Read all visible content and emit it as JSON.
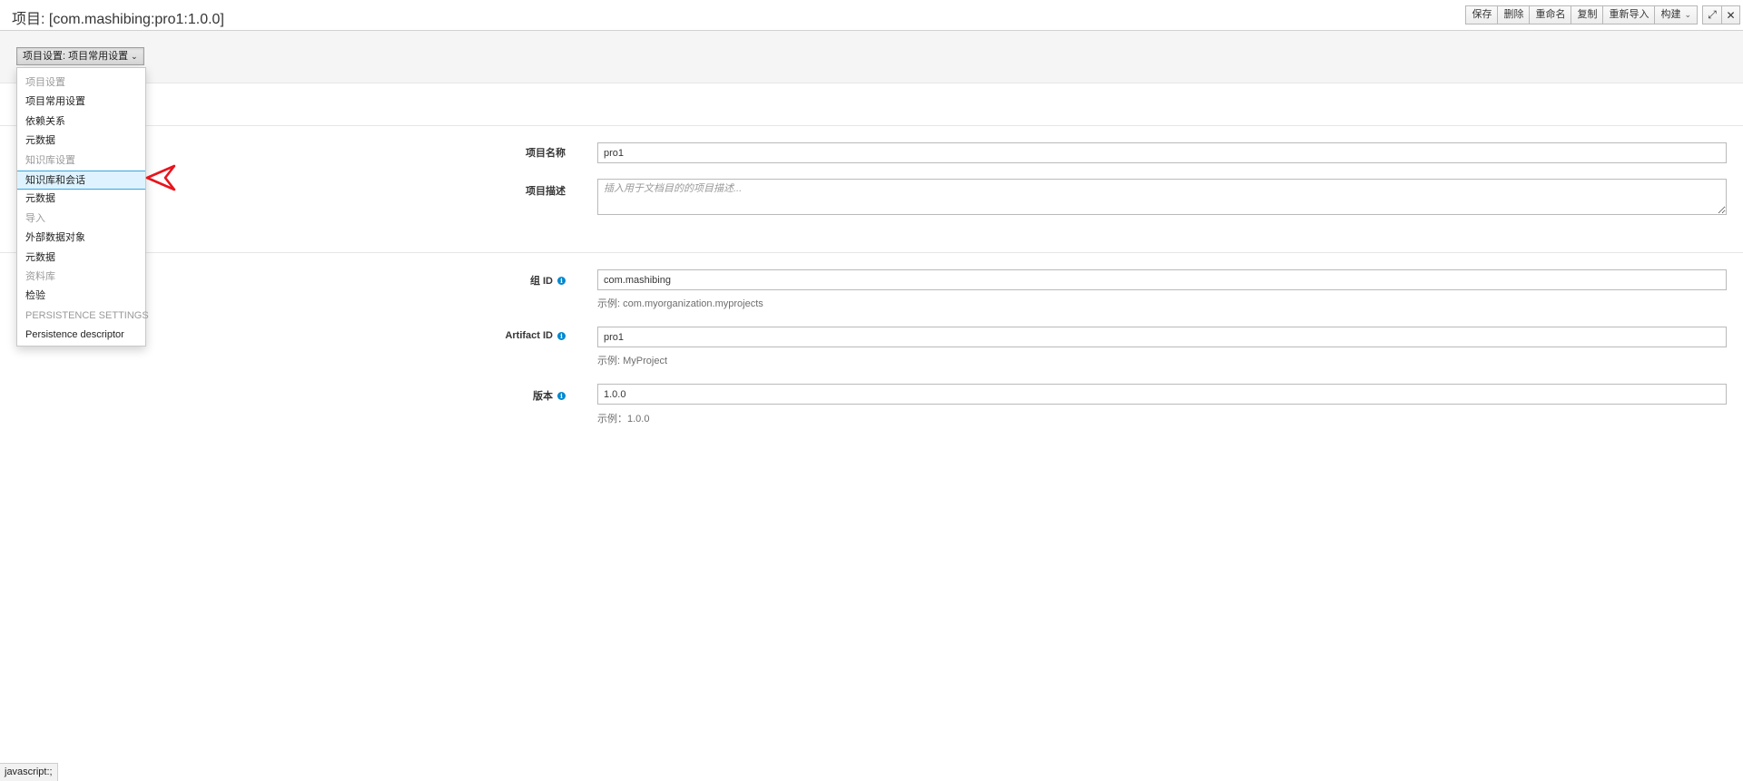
{
  "header": {
    "title": "项目: [com.mashibing:pro1:1.0.0]",
    "toolbar": [
      {
        "label": "保存",
        "name": "save-button"
      },
      {
        "label": "删除",
        "name": "delete-button"
      },
      {
        "label": "重命名",
        "name": "rename-button"
      },
      {
        "label": "复制",
        "name": "copy-button"
      },
      {
        "label": "重新导入",
        "name": "reimport-button"
      },
      {
        "label": "构建",
        "name": "build-button",
        "dropdown": true
      }
    ],
    "window_controls": {
      "maximize_icon": "expand-icon",
      "close_icon": "close-icon"
    }
  },
  "settings_bar": {
    "dropdown_label": "项目设置: 项目常用设置"
  },
  "menu": {
    "items": [
      {
        "label": "项目设置",
        "type": "header"
      },
      {
        "label": "项目常用设置",
        "type": "item"
      },
      {
        "label": "依赖关系",
        "type": "item"
      },
      {
        "label": "元数据",
        "type": "item"
      },
      {
        "label": "知识库设置",
        "type": "header"
      },
      {
        "label": "知识库和会话",
        "type": "item",
        "active": true
      },
      {
        "label": "元数据",
        "type": "item"
      },
      {
        "label": "导入",
        "type": "header"
      },
      {
        "label": "外部数据对象",
        "type": "item"
      },
      {
        "label": "元数据",
        "type": "item"
      },
      {
        "label": "资料库",
        "type": "header"
      },
      {
        "label": "检验",
        "type": "item"
      },
      {
        "label": "PERSISTENCE SETTINGS",
        "type": "header"
      },
      {
        "label": "Persistence descriptor",
        "type": "item"
      }
    ]
  },
  "form": {
    "project_name": {
      "label": "项目名称",
      "value": "pro1"
    },
    "project_description": {
      "label": "项目描述",
      "placeholder": "插入用于文档目的的项目描述..."
    },
    "group_id": {
      "label": "组 ID",
      "value": "com.mashibing",
      "help": "示例: com.myorganization.myprojects"
    },
    "artifact_id": {
      "label": "Artifact ID",
      "value": "pro1",
      "help": "示例: MyProject"
    },
    "version": {
      "label": "版本",
      "value": "1.0.0",
      "help": "示例：1.0.0"
    }
  },
  "status": {
    "text": "javascript:;"
  },
  "colors": {
    "accent": "#0088ce",
    "active_bg": "#def3ff",
    "annotation": "#e8141c"
  }
}
